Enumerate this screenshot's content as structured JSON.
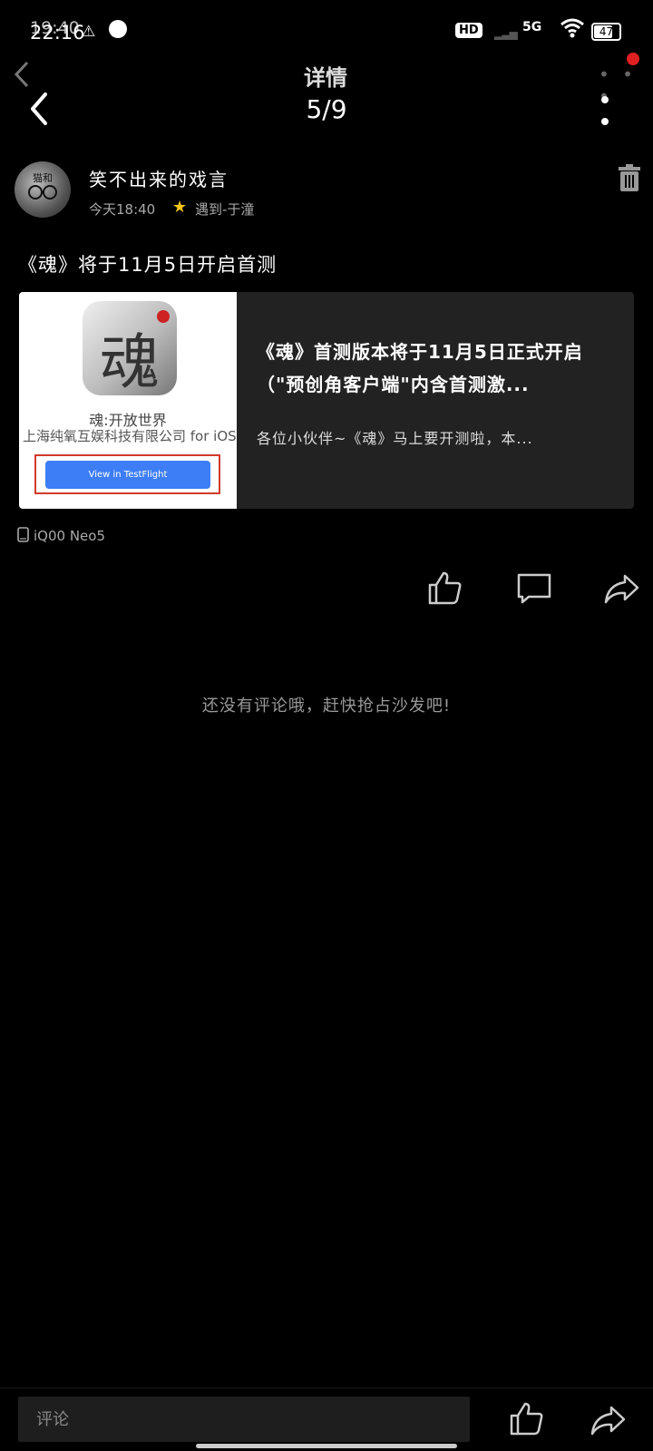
{
  "status_bar": {
    "time_ghost": "19:40",
    "time": "22:16",
    "alert_glyph": "⚠",
    "hd_label": "HD",
    "network_label": "5G",
    "battery_level": "47"
  },
  "ghost_header": {
    "title": "详情"
  },
  "header": {
    "counter": "5/9",
    "back_icon": "chevron-left-icon",
    "more_icon": "more-vertical-icon"
  },
  "author": {
    "name": "笑不出来的戏言",
    "time": "今天18:40",
    "topic": "遇到-于潼",
    "topic_icon": "star-icon",
    "avatar_text": "猫和"
  },
  "post": {
    "title": "《魂》将于11月5日开启首测",
    "link_card": {
      "title": "《魂》首测版本将于11月5日正式开启（\"预创角客户端\"内含首测激...",
      "description": "各位小伙伴~《魂》马上要开测啦，本...",
      "thumbnail": {
        "icon_glyph": "魂",
        "app_name": "魂:开放世界",
        "company": "上海纯氧互娱科技有限公司 for iOS",
        "button_label": "View in TestFlight"
      }
    },
    "device": "iQ00 Neo5"
  },
  "actions": {
    "like_icon": "thumbs-up-icon",
    "comment_icon": "comment-icon",
    "share_icon": "share-icon"
  },
  "comments": {
    "empty_text": "还没有评论哦，赶快抢占沙发吧!"
  },
  "bottom_bar": {
    "comment_placeholder": "评论"
  },
  "colors": {
    "background": "#000000",
    "accent_red": "#e02020",
    "testflight_blue": "#3d7ef6",
    "topic_star": "#f5c518"
  }
}
